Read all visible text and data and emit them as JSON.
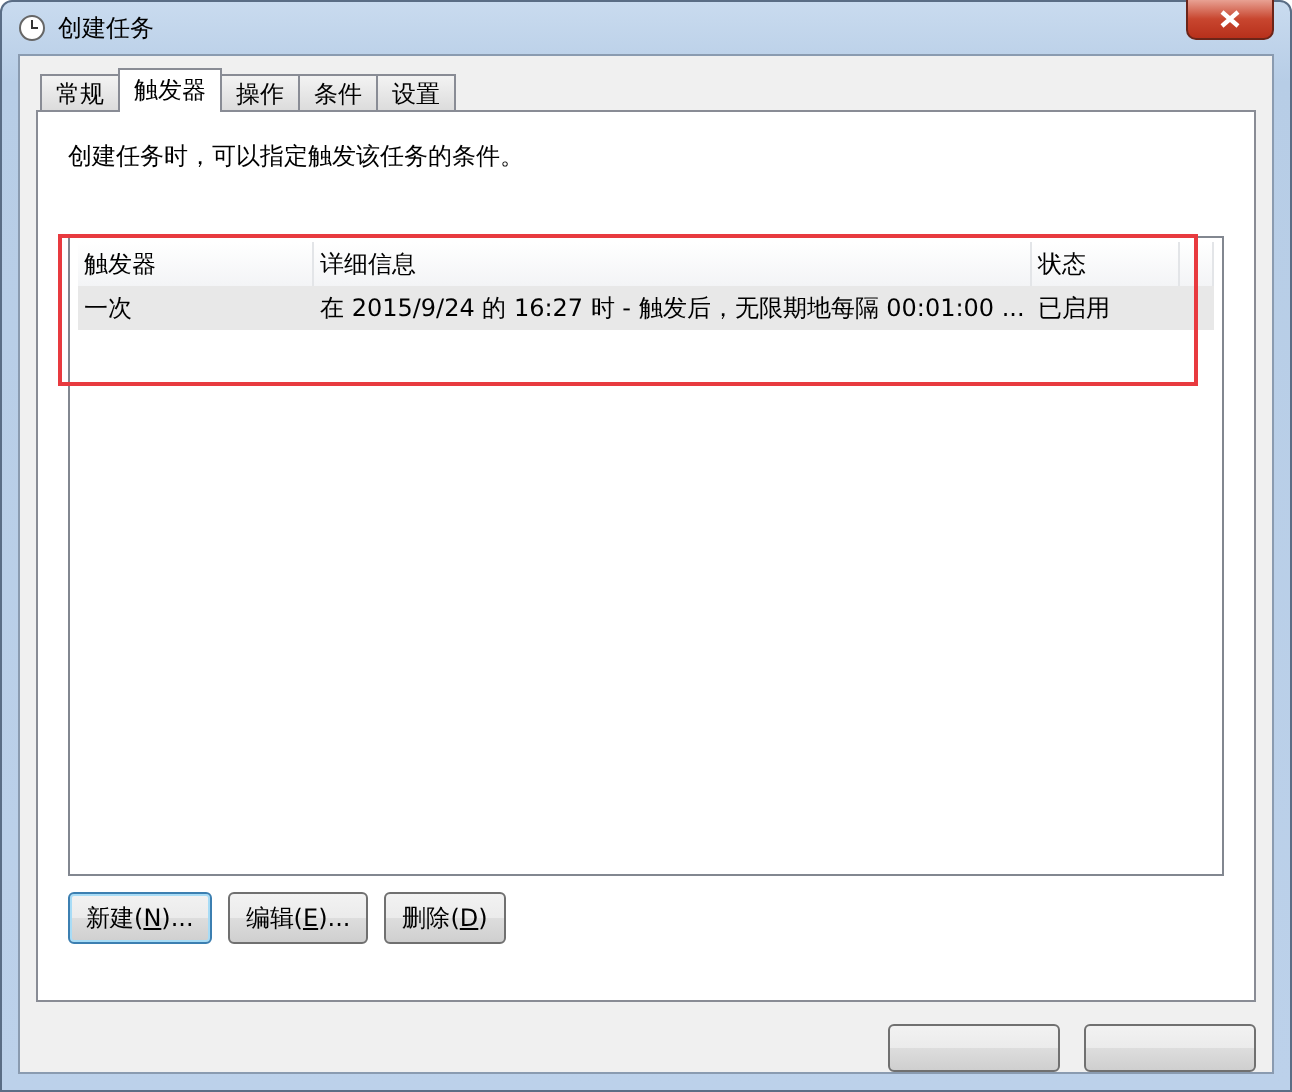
{
  "window": {
    "title": "创建任务"
  },
  "tabs": [
    {
      "label": "常规",
      "selected": false
    },
    {
      "label": "触发器",
      "selected": true
    },
    {
      "label": "操作",
      "selected": false
    },
    {
      "label": "条件",
      "selected": false
    },
    {
      "label": "设置",
      "selected": false
    }
  ],
  "description": "创建任务时，可以指定触发该任务的条件。",
  "table": {
    "columns": [
      "触发器",
      "详细信息",
      "状态"
    ],
    "rows": [
      {
        "cells": [
          "一次",
          "在 2015/9/24 的 16:27 时 - 触发后，无限期地每隔 00:01:00 ...",
          "已启用"
        ],
        "selected": true
      }
    ]
  },
  "buttons": [
    {
      "before": "新建(",
      "key": "N",
      "after": ")...",
      "focused": true
    },
    {
      "before": "编辑(",
      "key": "E",
      "after": ")...",
      "focused": false
    },
    {
      "before": "删除(",
      "key": "D",
      "after": ")",
      "focused": false
    }
  ],
  "dialog_buttons": [
    {
      "kind": "blank"
    },
    {
      "kind": "blank"
    }
  ],
  "annotation": {
    "kind": "highlight"
  }
}
